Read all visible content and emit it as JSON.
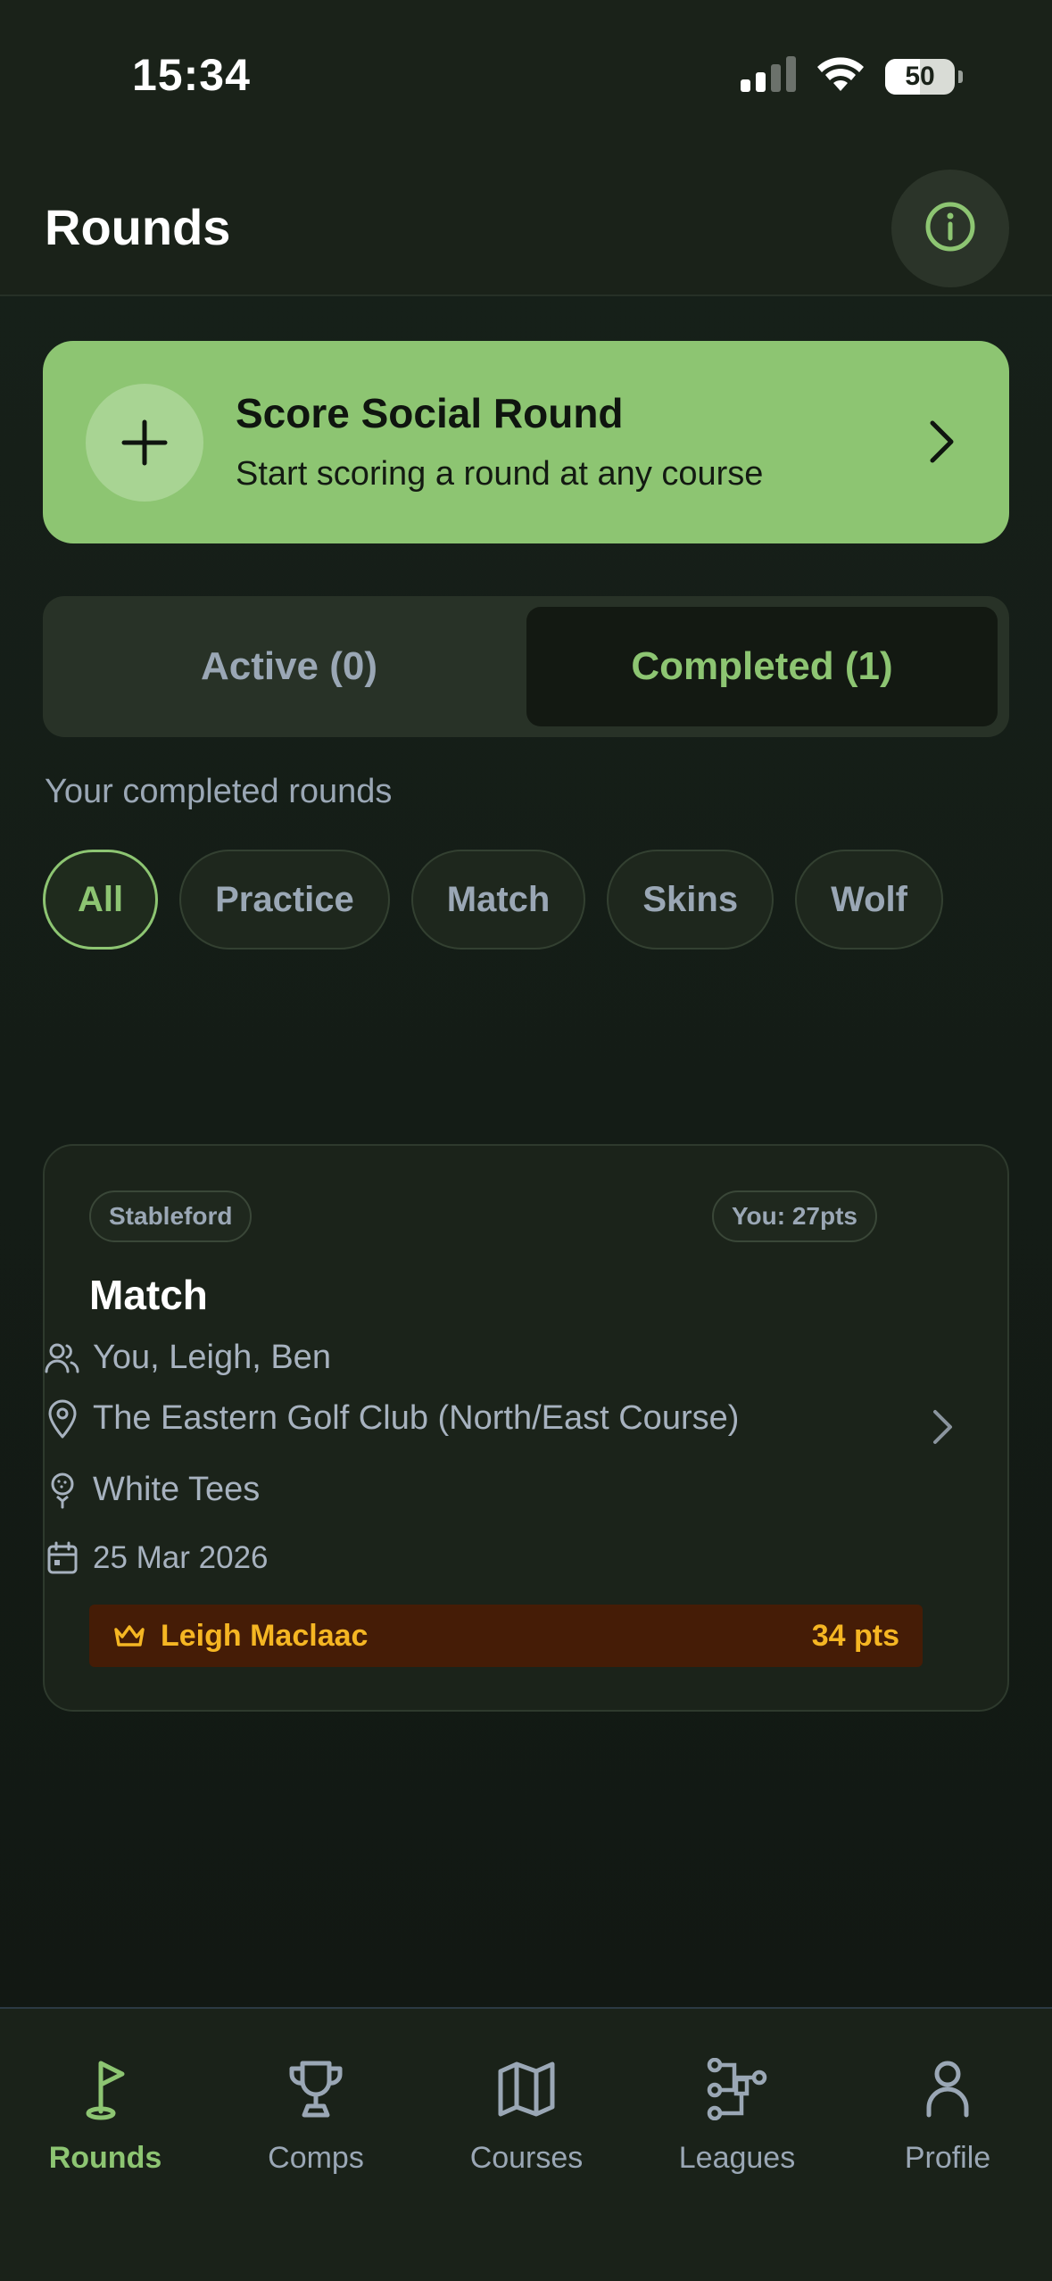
{
  "status_bar": {
    "time": "15:34",
    "battery": "50"
  },
  "header": {
    "title": "Rounds"
  },
  "social_round": {
    "title": "Score Social Round",
    "subtitle": "Start scoring a round at any course"
  },
  "segments": [
    {
      "label": "Active (0)",
      "selected": false
    },
    {
      "label": "Completed (1)",
      "selected": true
    }
  ],
  "section_label": "Your completed rounds",
  "filters": [
    {
      "label": "All",
      "selected": true
    },
    {
      "label": "Practice",
      "selected": false
    },
    {
      "label": "Match",
      "selected": false
    },
    {
      "label": "Skins",
      "selected": false
    },
    {
      "label": "Wolf",
      "selected": false
    }
  ],
  "round": {
    "format": "Stableford",
    "your_score": "You: 27pts",
    "title": "Match",
    "players": "You, Leigh, Ben",
    "course": "The Eastern Golf Club (North/East Course)",
    "tees": "White Tees",
    "date": "25 Mar 2026",
    "winner_name": "Leigh Maclaac",
    "winner_points": "34 pts"
  },
  "tabs": [
    {
      "label": "Rounds",
      "icon": "flag-icon",
      "active": true
    },
    {
      "label": "Comps",
      "icon": "trophy-icon",
      "active": false
    },
    {
      "label": "Courses",
      "icon": "map-icon",
      "active": false
    },
    {
      "label": "Leagues",
      "icon": "bracket-icon",
      "active": false
    },
    {
      "label": "Profile",
      "icon": "user-icon",
      "active": false
    }
  ],
  "colors": {
    "accent": "#8dc572",
    "background": "#111712",
    "card": "#1b231a",
    "winner_bg": "#451c06",
    "winner_text": "#f5b623",
    "muted_text": "#9aa7b5"
  }
}
